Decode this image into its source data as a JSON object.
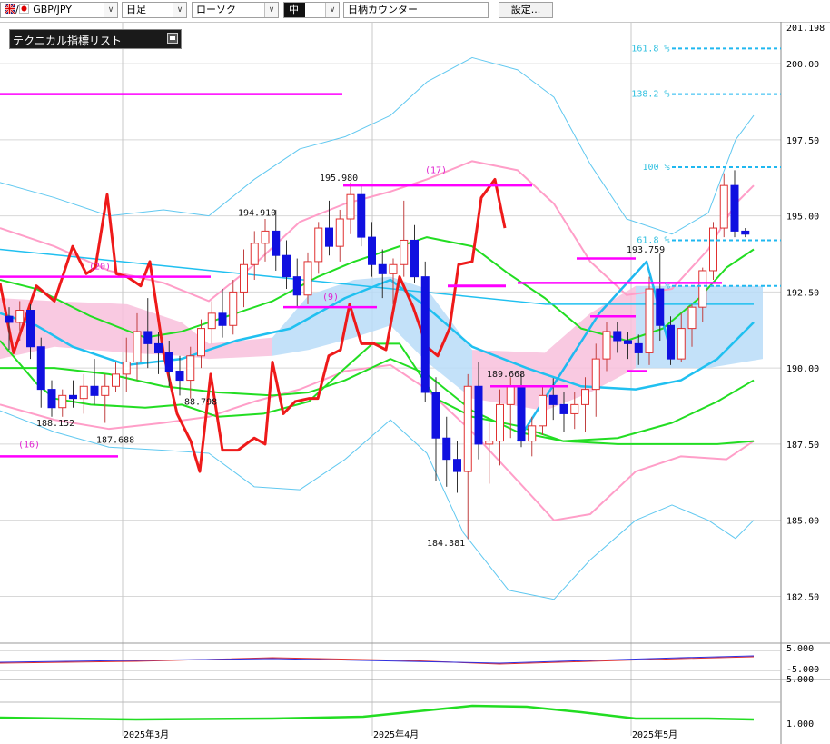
{
  "toolbar": {
    "symbol": "GBP/JPY",
    "period": "日足",
    "chart_style": "ローソク",
    "size": "中",
    "counter": "日柄カウンター",
    "settings": "設定..."
  },
  "indicator_panel": {
    "title": "テクニカル指標リスト"
  },
  "colors": {
    "bull": "#e03030",
    "bear": "#1010e0",
    "magenta": "#ff00ff",
    "bb_outer": "#60c8f0",
    "bb_mid": "#ff9ec8",
    "ma_green": "#22dd22",
    "ma_cyan": "#20c0f0",
    "cloud": "#b8dcf8",
    "cloud_pink": "#f8c0dc"
  },
  "chart_data": {
    "type": "candlestick",
    "symbol": "GBP/JPY",
    "yticks": [
      "201.198",
      "200.00",
      "197.50",
      "195.00",
      "192.50",
      "190.00",
      "187.50",
      "185.00",
      "182.50"
    ],
    "ylim": [
      181.2,
      201.198
    ],
    "xticks": [
      "2025年3月",
      "2025年4月",
      "2025年5月"
    ],
    "annotations": {
      "a1": "194.910",
      "a2": "195.980",
      "a3": "188.152",
      "a4": "187.688",
      "a5": "88.798",
      "a6": "184.381",
      "a7": "189.668",
      "a8": "193.759"
    },
    "counts": [
      "(20)",
      "(17)",
      "(9)",
      "(16)"
    ],
    "fib_levels": [
      {
        "label": "161.8 %",
        "value": 200.5
      },
      {
        "label": "138.2 %",
        "value": 199.0
      },
      {
        "label": "100 %",
        "value": 196.6
      },
      {
        "label": "61.8 %",
        "value": 194.2
      },
      {
        "label": "%",
        "value": 192.7
      }
    ],
    "sub_ticks": [
      "5.000",
      "-5.000",
      "5.000",
      "1.000"
    ],
    "candles": [
      [
        191.7,
        192.0,
        190.6,
        191.5
      ],
      [
        191.5,
        192.2,
        190.9,
        191.9
      ],
      [
        191.9,
        192.1,
        190.3,
        190.7
      ],
      [
        190.7,
        191.0,
        188.7,
        189.3
      ],
      [
        189.3,
        189.6,
        188.4,
        188.7
      ],
      [
        188.7,
        189.3,
        188.4,
        189.1
      ],
      [
        189.1,
        189.6,
        188.7,
        189.0
      ],
      [
        189.0,
        189.8,
        188.5,
        189.4
      ],
      [
        189.4,
        190.3,
        188.8,
        189.1
      ],
      [
        189.1,
        189.8,
        188.2,
        189.4
      ],
      [
        189.4,
        190.2,
        189.2,
        189.8
      ],
      [
        189.8,
        191.0,
        189.2,
        190.2
      ],
      [
        190.2,
        191.8,
        189.6,
        191.2
      ],
      [
        191.2,
        192.3,
        190.0,
        190.8
      ],
      [
        190.8,
        191.2,
        189.8,
        190.5
      ],
      [
        190.5,
        190.9,
        189.4,
        189.9
      ],
      [
        189.9,
        190.4,
        189.1,
        189.6
      ],
      [
        189.6,
        190.7,
        189.0,
        190.4
      ],
      [
        190.4,
        191.6,
        190.0,
        191.3
      ],
      [
        191.3,
        192.2,
        190.8,
        191.8
      ],
      [
        191.8,
        192.6,
        191.0,
        191.4
      ],
      [
        191.4,
        192.9,
        191.1,
        192.5
      ],
      [
        192.5,
        193.9,
        192.0,
        193.4
      ],
      [
        193.4,
        194.5,
        192.9,
        194.1
      ],
      [
        194.1,
        194.9,
        193.5,
        194.5
      ],
      [
        194.5,
        195.2,
        193.2,
        193.7
      ],
      [
        193.7,
        194.2,
        192.6,
        193.0
      ],
      [
        193.0,
        193.6,
        192.0,
        192.4
      ],
      [
        192.4,
        193.8,
        192.1,
        193.5
      ],
      [
        193.5,
        194.8,
        193.1,
        194.6
      ],
      [
        194.6,
        195.5,
        193.7,
        194.0
      ],
      [
        194.0,
        195.2,
        193.5,
        194.9
      ],
      [
        194.9,
        196.1,
        194.4,
        195.7
      ],
      [
        195.7,
        195.98,
        194.0,
        194.3
      ],
      [
        194.3,
        194.8,
        193.0,
        193.4
      ],
      [
        193.4,
        193.9,
        192.3,
        193.1
      ],
      [
        193.1,
        193.6,
        192.1,
        193.4
      ],
      [
        193.4,
        195.5,
        193.0,
        194.2
      ],
      [
        194.2,
        194.7,
        192.8,
        193.0
      ],
      [
        193.0,
        193.5,
        188.9,
        189.2
      ],
      [
        189.2,
        189.7,
        186.3,
        187.7
      ],
      [
        187.7,
        188.4,
        186.1,
        187.0
      ],
      [
        187.0,
        187.6,
        185.9,
        186.6
      ],
      [
        186.6,
        189.8,
        184.381,
        189.4
      ],
      [
        189.4,
        190.2,
        187.0,
        187.5
      ],
      [
        187.5,
        188.2,
        186.2,
        187.6
      ],
      [
        187.6,
        189.3,
        186.8,
        188.8
      ],
      [
        188.8,
        189.7,
        187.7,
        189.4
      ],
      [
        189.4,
        189.8,
        187.4,
        187.6
      ],
      [
        187.6,
        188.4,
        187.1,
        188.1
      ],
      [
        188.1,
        189.4,
        187.8,
        189.1
      ],
      [
        189.1,
        189.668,
        188.3,
        188.8
      ],
      [
        188.8,
        189.2,
        187.9,
        188.5
      ],
      [
        188.5,
        189.2,
        188.0,
        188.8
      ],
      [
        188.8,
        189.7,
        187.9,
        189.3
      ],
      [
        189.3,
        190.8,
        188.4,
        190.3
      ],
      [
        190.3,
        191.5,
        189.9,
        191.2
      ],
      [
        191.2,
        191.5,
        190.5,
        190.9
      ],
      [
        190.9,
        191.2,
        190.3,
        190.8
      ],
      [
        190.8,
        191.1,
        190.1,
        190.5
      ],
      [
        190.5,
        193.0,
        190.1,
        192.6
      ],
      [
        192.6,
        193.759,
        190.9,
        191.4
      ],
      [
        191.4,
        191.7,
        190.1,
        190.3
      ],
      [
        190.3,
        191.8,
        190.2,
        191.3
      ],
      [
        191.3,
        192.1,
        190.7,
        192.0
      ],
      [
        192.0,
        193.3,
        191.5,
        193.2
      ],
      [
        193.2,
        194.8,
        192.9,
        194.6
      ],
      [
        194.6,
        196.4,
        194.3,
        196.0
      ],
      [
        196.0,
        196.5,
        194.3,
        194.5
      ],
      [
        194.5,
        194.6,
        194.3,
        194.4
      ]
    ]
  }
}
